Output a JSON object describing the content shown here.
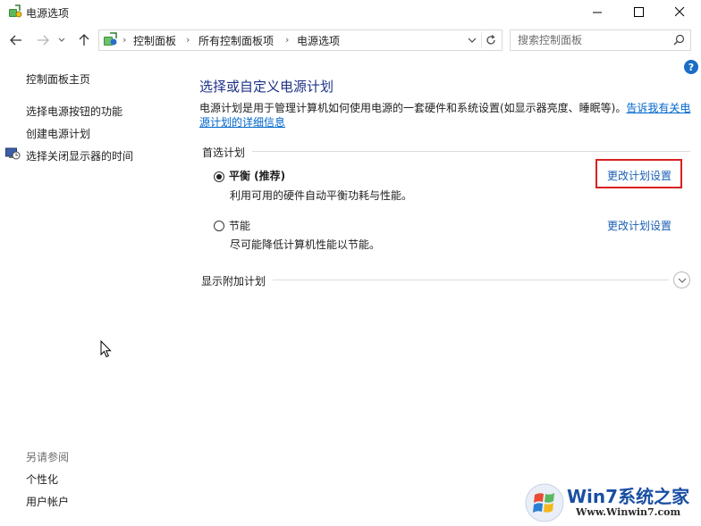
{
  "window": {
    "title": "电源选项",
    "controls": {
      "minimize": "minimize-icon",
      "maximize": "maximize-icon",
      "close": "close-icon"
    }
  },
  "address_bar": {
    "breadcrumbs": [
      "控制面板",
      "所有控制面板项",
      "电源选项"
    ],
    "separator": "›"
  },
  "search": {
    "placeholder": "搜索控制面板"
  },
  "sidebar": {
    "home_link": "控制面板主页",
    "tasks": [
      "选择电源按钮的功能",
      "创建电源计划",
      "选择关闭显示器的时间"
    ],
    "see_also_label": "另请参阅",
    "see_also": [
      "个性化",
      "用户帐户"
    ]
  },
  "main": {
    "help_label": "?",
    "heading": "选择或自定义电源计划",
    "intro_text": "电源计划是用于管理计算机如何使用电源的一套硬件和系统设置(如显示器亮度、睡眠等)。",
    "intro_link": "告诉我有关电源计划的详细信息",
    "preferred_label": "首选计划",
    "plans": [
      {
        "name": "平衡 (推荐)",
        "desc": "利用可用的硬件自动平衡功耗与性能。",
        "selected": true,
        "change_label": "更改计划设置"
      },
      {
        "name": "节能",
        "desc": "尽可能降低计算机性能以节能。",
        "selected": false,
        "change_label": "更改计划设置"
      }
    ],
    "additional_label": "显示附加计划"
  },
  "watermark": {
    "title": "Win7系统之家",
    "url": "Www.Winwin7.com"
  },
  "colors": {
    "heading": "#1e3287",
    "link": "#1a5fb4",
    "highlight": "#d92020",
    "help": "#1a6dc6"
  }
}
